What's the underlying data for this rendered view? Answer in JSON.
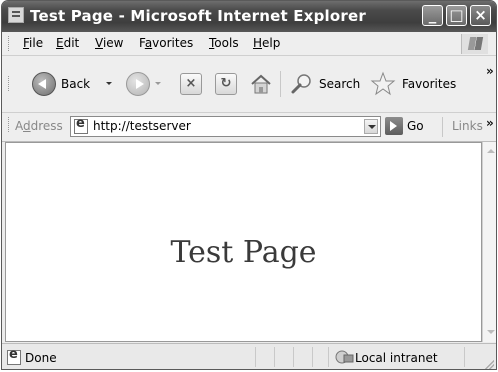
{
  "window": {
    "title": "Test Page - Microsoft Internet Explorer",
    "min_glyph": "_",
    "max_glyph": "□",
    "close_glyph": "×"
  },
  "menu": {
    "items": [
      {
        "label": "File",
        "mnemonic": "F"
      },
      {
        "label": "Edit",
        "mnemonic": "E"
      },
      {
        "label": "View",
        "mnemonic": "V"
      },
      {
        "label": "Favorites",
        "mnemonic": "a"
      },
      {
        "label": "Tools",
        "mnemonic": "T"
      },
      {
        "label": "Help",
        "mnemonic": "H"
      }
    ]
  },
  "toolbar": {
    "back_label": "Back",
    "search_label": "Search",
    "favorites_label": "Favorites",
    "stop_glyph": "×",
    "refresh_glyph": "↻",
    "chevron": "»",
    "icons": [
      "back-arrow-icon",
      "forward-arrow-icon",
      "stop-icon",
      "refresh-icon",
      "home-icon",
      "search-icon",
      "favorites-star-icon"
    ]
  },
  "address": {
    "label": "Address",
    "mnemonic": "d",
    "value": "http://testserver",
    "go_label": "Go",
    "links_label": "Links",
    "chevron": "»"
  },
  "content": {
    "heading": "Test Page"
  },
  "status": {
    "text": "Done",
    "zone": "Local intranet"
  }
}
